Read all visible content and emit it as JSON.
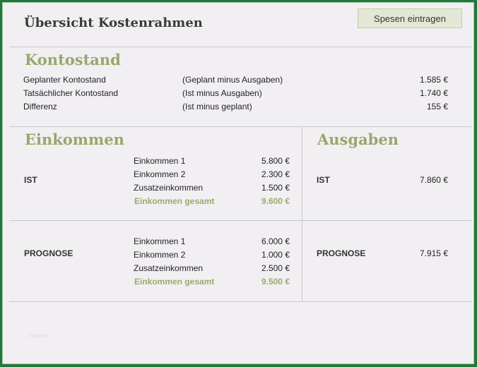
{
  "header": {
    "title": "Übersicht Kostenrahmen",
    "button_label": "Spesen eintragen"
  },
  "kontostand": {
    "heading": "Kontostand",
    "rows": [
      {
        "label": "Geplanter Kontostand",
        "note": "(Geplant minus Ausgaben)",
        "value": "1.585 €"
      },
      {
        "label": "Tatsächlicher Kontostand",
        "note": "(Ist minus Ausgaben)",
        "value": "1.740 €"
      },
      {
        "label": "Differenz",
        "note": "(Ist minus geplant)",
        "value": "155 €"
      }
    ]
  },
  "einkommen": {
    "heading": "Einkommen",
    "ist": {
      "label": "IST",
      "items": [
        {
          "label": "Einkommen 1",
          "value": "5.800 €"
        },
        {
          "label": "Einkommen 2",
          "value": "2.300 €"
        },
        {
          "label": "Zusatzeinkommen",
          "value": "1.500 €"
        }
      ],
      "total_label": "Einkommen gesamt",
      "total_value": "9.600 €"
    },
    "prognose": {
      "label": "PROGNOSE",
      "items": [
        {
          "label": "Einkommen 1",
          "value": "6.000 €"
        },
        {
          "label": "Einkommen 2",
          "value": "1.000 €"
        },
        {
          "label": "Zusatzeinkommen",
          "value": "2.500 €"
        }
      ],
      "total_label": "Einkommen gesamt",
      "total_value": "9.500 €"
    }
  },
  "ausgaben": {
    "heading": "Ausgaben",
    "ist": {
      "label": "IST",
      "value": "7.860 €"
    },
    "prognose": {
      "label": "PROGNOSE",
      "value": "7.915 €"
    }
  },
  "watermark": "mgvexn",
  "colors": {
    "accent_green": "#98a86a",
    "frame_border": "#1f7a3a",
    "button_bg": "#e3e8d6",
    "panel_bg": "#f2eff3"
  }
}
